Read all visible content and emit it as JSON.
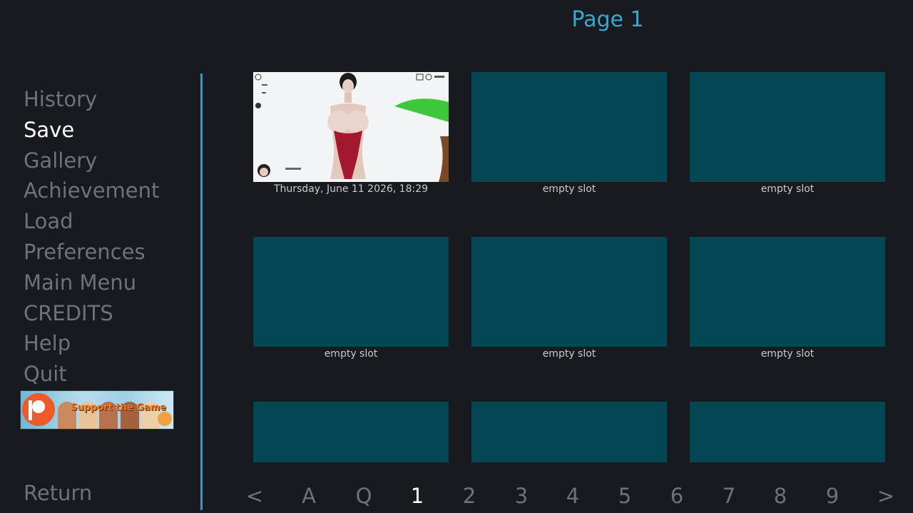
{
  "header": {
    "title": "Page 1"
  },
  "nav": {
    "items": [
      {
        "label": "History",
        "active": false
      },
      {
        "label": "Save",
        "active": true
      },
      {
        "label": "Gallery",
        "active": false
      },
      {
        "label": "Achievement",
        "active": false
      },
      {
        "label": "Load",
        "active": false
      },
      {
        "label": "Preferences",
        "active": false
      },
      {
        "label": "Main Menu",
        "active": false
      },
      {
        "label": "CREDITS",
        "active": false
      },
      {
        "label": "Help",
        "active": false
      },
      {
        "label": "Quit",
        "active": false
      }
    ],
    "return_label": "Return",
    "banner_text": "Support the Game"
  },
  "slots": [
    {
      "label": "Thursday, June 11 2026, 18:29",
      "filled": true
    },
    {
      "label": "empty slot",
      "filled": false
    },
    {
      "label": "empty slot",
      "filled": false
    },
    {
      "label": "empty slot",
      "filled": false
    },
    {
      "label": "empty slot",
      "filled": false
    },
    {
      "label": "empty slot",
      "filled": false
    },
    {
      "label": "",
      "filled": false
    },
    {
      "label": "",
      "filled": false
    },
    {
      "label": "",
      "filled": false
    }
  ],
  "pagination": {
    "prev": "<",
    "auto": "A",
    "quick": "Q",
    "pages": [
      "1",
      "2",
      "3",
      "4",
      "5",
      "6",
      "7",
      "8",
      "9"
    ],
    "next": ">",
    "current": "1"
  },
  "colors": {
    "background": "#171b1f",
    "accent": "#38a8d0",
    "divider": "#3a95c4",
    "slot_empty": "#044754",
    "nav_idle": "#6f7276",
    "nav_active": "#ffffff"
  }
}
